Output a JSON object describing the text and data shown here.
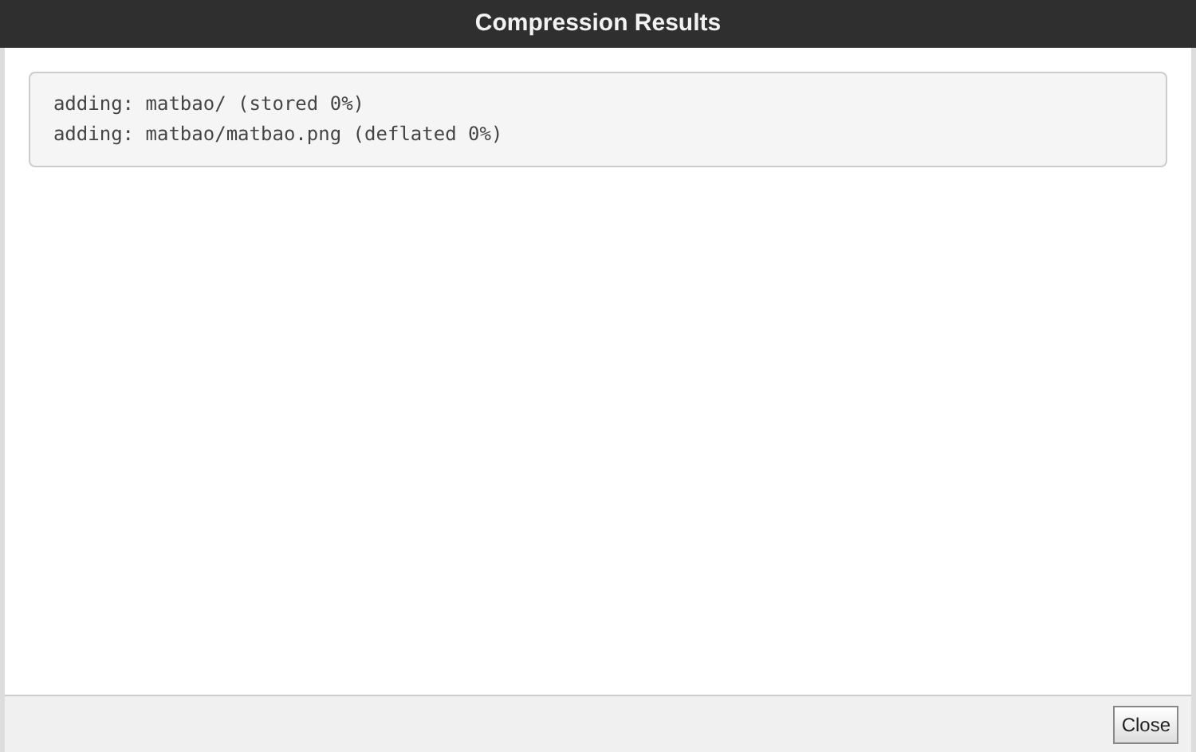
{
  "window": {
    "title": "Compression Results"
  },
  "output_lines": [
    "  adding: matbao/ (stored 0%)",
    "  adding: matbao/matbao.png (deflated 0%)"
  ],
  "buttons": [
    {
      "label": "Close"
    }
  ]
}
